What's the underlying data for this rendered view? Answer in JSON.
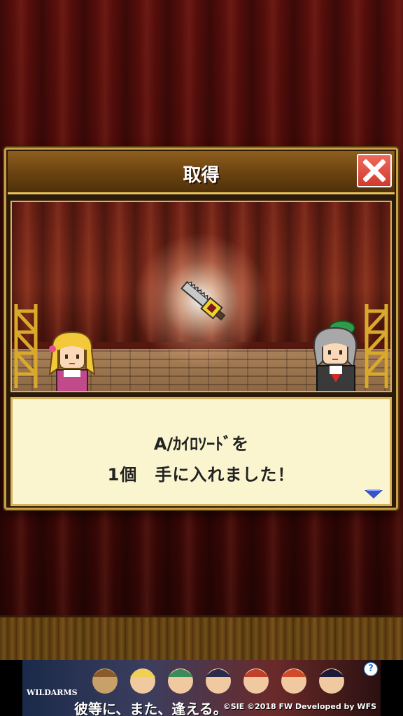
{
  "dialog": {
    "title": "取得",
    "close_icon": "close-x-icon"
  },
  "scene": {
    "item_icon": "chainsaw-sword-icon",
    "left_character": "blonde-girl-sprite",
    "right_character": "grey-haired-woman-green-hat-sprite"
  },
  "message": {
    "line1": "A/ｶｲﾛｿｰﾄﾞを",
    "line2": "1個　手に入れました！",
    "next_icon": "down-triangle-icon"
  },
  "ad": {
    "logo": "WILDARMS",
    "tagline": "彼等に、また、逢える。",
    "copyright": "©SIE ©2018 FW Developed by WFS",
    "info_label": "?"
  },
  "colors": {
    "frame_gold": "#c9a046",
    "title_brown": "#6a4210",
    "close_red": "#cf3a2e",
    "message_bg": "#faf5cf",
    "curtain_red": "#4b0b09"
  }
}
